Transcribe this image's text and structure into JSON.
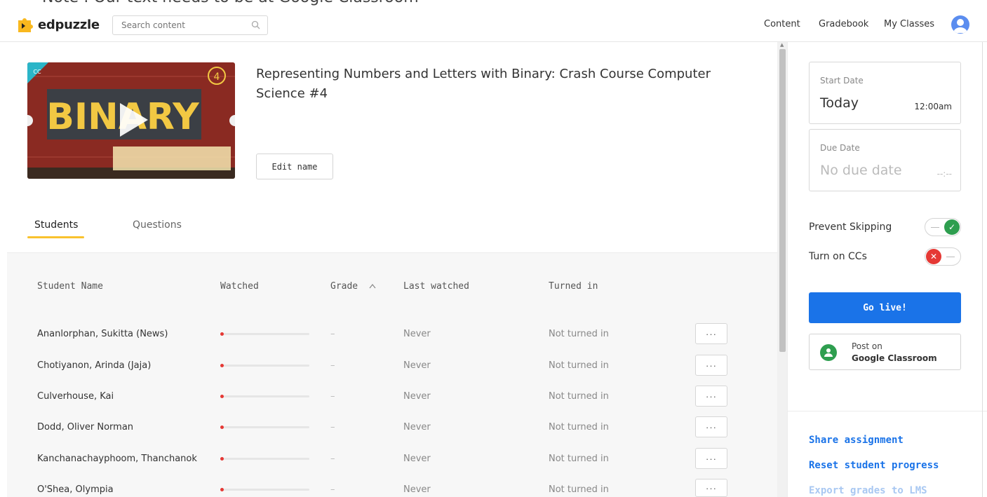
{
  "top_strip": "Note : Our text needs to be at Google Classroom",
  "header": {
    "logo_text": "edpuzzle",
    "search_placeholder": "Search content",
    "nav": [
      "Content",
      "Gradebook",
      "My Classes"
    ]
  },
  "video": {
    "thumbnail_text": "BINARY",
    "thumbnail_badge": "CC",
    "thumbnail_episode": "4",
    "title": "Representing Numbers and Letters with Binary: Crash Course Computer Science #4",
    "edit_label": "Edit name"
  },
  "tabs": [
    "Students",
    "Questions"
  ],
  "table": {
    "headers": [
      "Student Name",
      "Watched",
      "Grade",
      "Last watched",
      "Turned in"
    ],
    "rows": [
      {
        "name": "Ananlorphan, Sukitta (News)",
        "watched": 0,
        "grade": "–",
        "last": "Never",
        "turned": "Not turned in"
      },
      {
        "name": "Chotiyanon, Arinda (Jaja)",
        "watched": 0,
        "grade": "–",
        "last": "Never",
        "turned": "Not turned in"
      },
      {
        "name": "Culverhouse, Kai",
        "watched": 0,
        "grade": "–",
        "last": "Never",
        "turned": "Not turned in"
      },
      {
        "name": "Dodd, Oliver Norman",
        "watched": 0,
        "grade": "–",
        "last": "Never",
        "turned": "Not turned in"
      },
      {
        "name": "Kanchanachayphoom, Thanchanok",
        "watched": 0,
        "grade": "–",
        "last": "Never",
        "turned": "Not turned in"
      },
      {
        "name": "O'Shea, Olympia",
        "watched": 0,
        "grade": "–",
        "last": "Never",
        "turned": "Not turned in"
      }
    ],
    "more_label": "···"
  },
  "panel": {
    "start_label": "Start Date",
    "start_value": "Today",
    "start_time": "12:00am",
    "due_label": "Due Date",
    "due_value": "No due date",
    "due_time": "--:--",
    "prevent_skipping_label": "Prevent Skipping",
    "prevent_skipping_on": true,
    "cc_label": "Turn on CCs",
    "cc_on": false,
    "go_live_label": "Go live!",
    "gc_line1": "Post on",
    "gc_line2": "Google Classroom",
    "links": [
      "Share assignment",
      "Reset student progress",
      "Export grades to LMS"
    ]
  },
  "colors": {
    "accent": "#1a73e8",
    "tab_underline": "#f9c22e",
    "toggle_on": "#2e9e4f",
    "toggle_off": "#e53935"
  }
}
